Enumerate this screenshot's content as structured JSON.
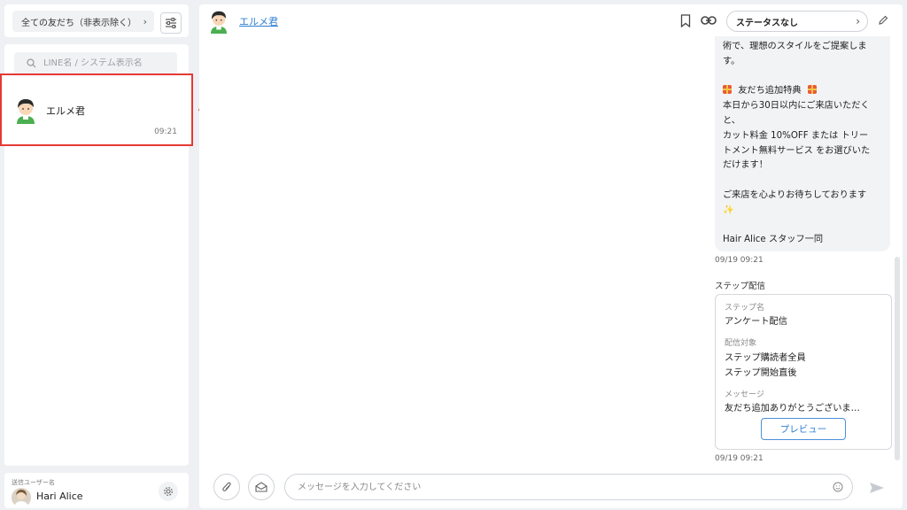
{
  "sidebar": {
    "filter_label": "全ての友だち（非表示除く）",
    "search_placeholder": "LINE名 / システム表示名",
    "friends": [
      {
        "name": "エルメ君",
        "time": "09:21"
      }
    ],
    "sender_label": "送信ユーザー名",
    "sender_name": "Hari Alice"
  },
  "chat": {
    "header_name": "エルメ君",
    "status": "ステータスなし",
    "message_lines": [
      "術で、理想のスタイルをご提案しま",
      "す。",
      "",
      "友だち追加特典",
      "本日から30日以内にご来店いただく",
      "と、",
      "カット料金 10%OFF または トリー",
      "トメント無料サービス をお選びいた",
      "だけます！",
      "",
      "ご来店を心よりお待ちしております",
      "✨",
      "",
      "Hair Alice スタッフ一同"
    ],
    "message_time": "09/19 09:21",
    "step_title": "ステップ配信",
    "step_name_label": "ステップ名",
    "step_name_value": "アンケート配信",
    "target_label": "配信対象",
    "target_line1": "ステップ購読者全員",
    "target_line2": "ステップ開始直後",
    "message_label": "メッセージ",
    "message_value": "友だち追加ありがとうございま…",
    "preview_label": "プレビュー",
    "step_time": "09/19 09:21",
    "input_placeholder": "メッセージを入力してください"
  },
  "colors": {
    "accent": "#2f7fd3",
    "highlight": "#e53935",
    "bubble": "#f2f3f5"
  }
}
